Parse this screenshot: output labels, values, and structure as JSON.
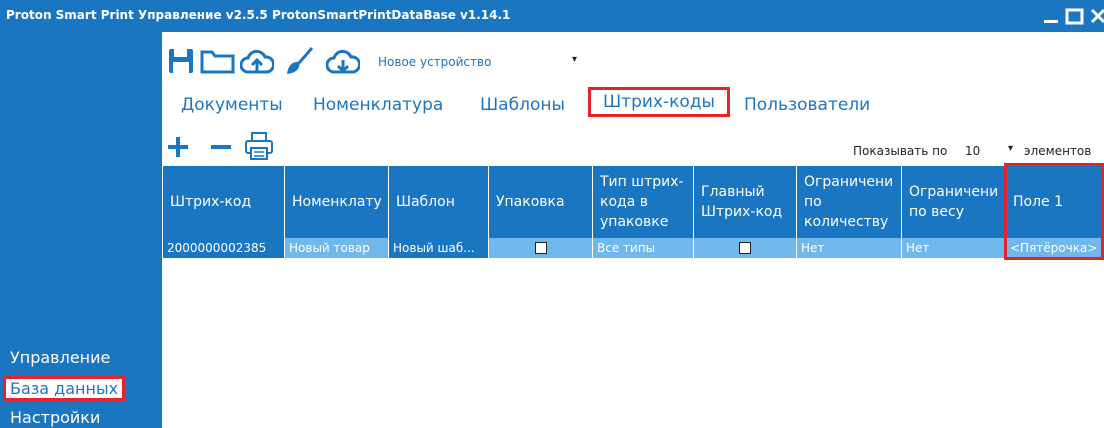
{
  "window": {
    "title": "Proton Smart Print Управление v2.5.5 ProtonSmartPrintDataBase v1.14.1"
  },
  "toolbar": {
    "device": "Новое устройство",
    "icons": [
      "save-icon",
      "folder-icon",
      "cloud-upload-icon",
      "broom-icon",
      "cloud-download-icon"
    ]
  },
  "tabs": [
    {
      "label": "Документы",
      "active": false
    },
    {
      "label": "Номенклатура",
      "active": false
    },
    {
      "label": "Шаблоны",
      "active": false
    },
    {
      "label": "Штрих-коды",
      "active": true
    },
    {
      "label": "Пользователи",
      "active": false
    }
  ],
  "actions": [
    "plus-icon",
    "minus-icon",
    "printer-icon"
  ],
  "paging": {
    "show_label": "Показывать по",
    "value": "10",
    "suffix": "элементов"
  },
  "table": {
    "columns": [
      "Штрих-код",
      "Номенклату",
      "Шаблон",
      "Упаковка",
      "Тип штрих-кода в упаковке",
      "Главный Штрих-код",
      "Ограничени по количеству",
      "Ограничени по весу",
      "Поле 1"
    ],
    "rows": [
      {
        "barcode": "2000000002385",
        "nomenclature": "Новый товар",
        "template": "Новый шаб...",
        "package": false,
        "barcode_type": "Все типы",
        "main_barcode": false,
        "limit_qty": "Нет",
        "limit_weight": "Нет",
        "field1": "<Пятёрочка>"
      }
    ]
  },
  "sidebar": {
    "items": [
      {
        "label": "Управление",
        "active": false
      },
      {
        "label": "База данных",
        "active": true
      },
      {
        "label": "Настройки",
        "active": false
      }
    ]
  },
  "colors": {
    "primary": "#1b76c2",
    "row_selected": "#70b8ea",
    "highlight": "#e3242b"
  }
}
